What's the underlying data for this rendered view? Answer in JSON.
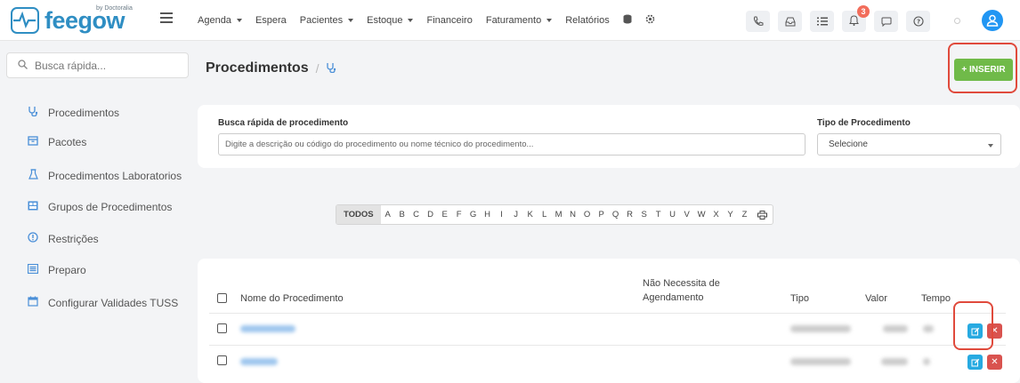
{
  "brand": {
    "name": "feegow",
    "tagline": "by Doctoralia",
    "color": "#2f8ec3"
  },
  "nav": {
    "items": [
      {
        "label": "Agenda",
        "dropdown": true
      },
      {
        "label": "Espera",
        "dropdown": false
      },
      {
        "label": "Pacientes",
        "dropdown": true
      },
      {
        "label": "Estoque",
        "dropdown": true
      },
      {
        "label": "Financeiro",
        "dropdown": false
      },
      {
        "label": "Faturamento",
        "dropdown": true
      },
      {
        "label": "Relatórios",
        "dropdown": false
      }
    ]
  },
  "topbar": {
    "notification_count": "3",
    "icons": [
      "database-icon",
      "gear-icon",
      "phone-icon",
      "inbox-icon",
      "list-icon",
      "bell-icon",
      "chat-icon",
      "help-icon",
      "user-avatar-icon"
    ]
  },
  "sidebar": {
    "search_placeholder": "Busca rápida...",
    "items": [
      {
        "label": "Procedimentos",
        "icon": "stethoscope-icon"
      },
      {
        "label": "Pacotes",
        "icon": "package-icon"
      },
      {
        "label": "Procedimentos Laboratorios",
        "icon": "flask-icon"
      },
      {
        "label": "Grupos de Procedimentos",
        "icon": "group-icon"
      },
      {
        "label": "Restrições",
        "icon": "restriction-icon"
      },
      {
        "label": "Preparo",
        "icon": "preparation-icon"
      },
      {
        "label": "Configurar Validades TUSS",
        "icon": "calendar-icon"
      }
    ]
  },
  "page": {
    "title": "Procedimentos",
    "insert_label": "+ INSERIR",
    "accent": "#70ba49"
  },
  "filters": {
    "search_label": "Busca rápida de procedimento",
    "search_placeholder": "Digite a descrição ou código do procedimento ou nome técnico do procedimento...",
    "type_label": "Tipo de Procedimento",
    "type_value": "Selecione"
  },
  "alphabet": {
    "all_label": "TODOS",
    "letters": [
      "A",
      "B",
      "C",
      "D",
      "E",
      "F",
      "G",
      "H",
      "I",
      "J",
      "K",
      "L",
      "M",
      "N",
      "O",
      "P",
      "Q",
      "R",
      "S",
      "T",
      "U",
      "V",
      "W",
      "X",
      "Y",
      "Z"
    ]
  },
  "table": {
    "headers": {
      "name": "Nome do Procedimento",
      "no_schedule_1": "Não Necessita de",
      "no_schedule_2": "Agendamento",
      "type": "Tipo",
      "value": "Valor",
      "time": "Tempo"
    },
    "rows": 2
  },
  "highlight_color": "#e04a3c"
}
